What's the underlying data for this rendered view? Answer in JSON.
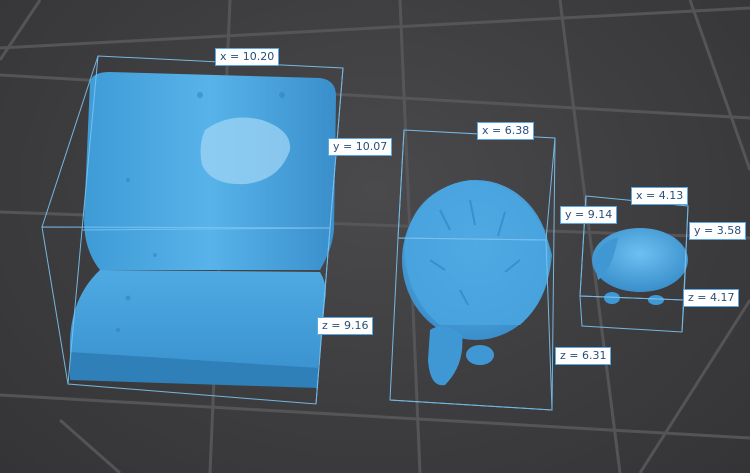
{
  "viewport": {
    "background": "#3d3d3f",
    "grid_color": "#555558",
    "model_color": "#4aa8e0",
    "box_color": "#7cc4f2"
  },
  "models": [
    {
      "name": "terrain-base",
      "labels": {
        "x": "x = 10.20",
        "y": "y = 10.07",
        "z": "z = 9.16"
      }
    },
    {
      "name": "hedgehog-large",
      "labels": {
        "x": "x = 6.38",
        "y": "y = 9.14",
        "z": "z = 6.31"
      }
    },
    {
      "name": "hedgehog-small",
      "labels": {
        "x": "x = 4.13",
        "y": "y = 3.58",
        "z": "z = 4.17"
      }
    }
  ]
}
